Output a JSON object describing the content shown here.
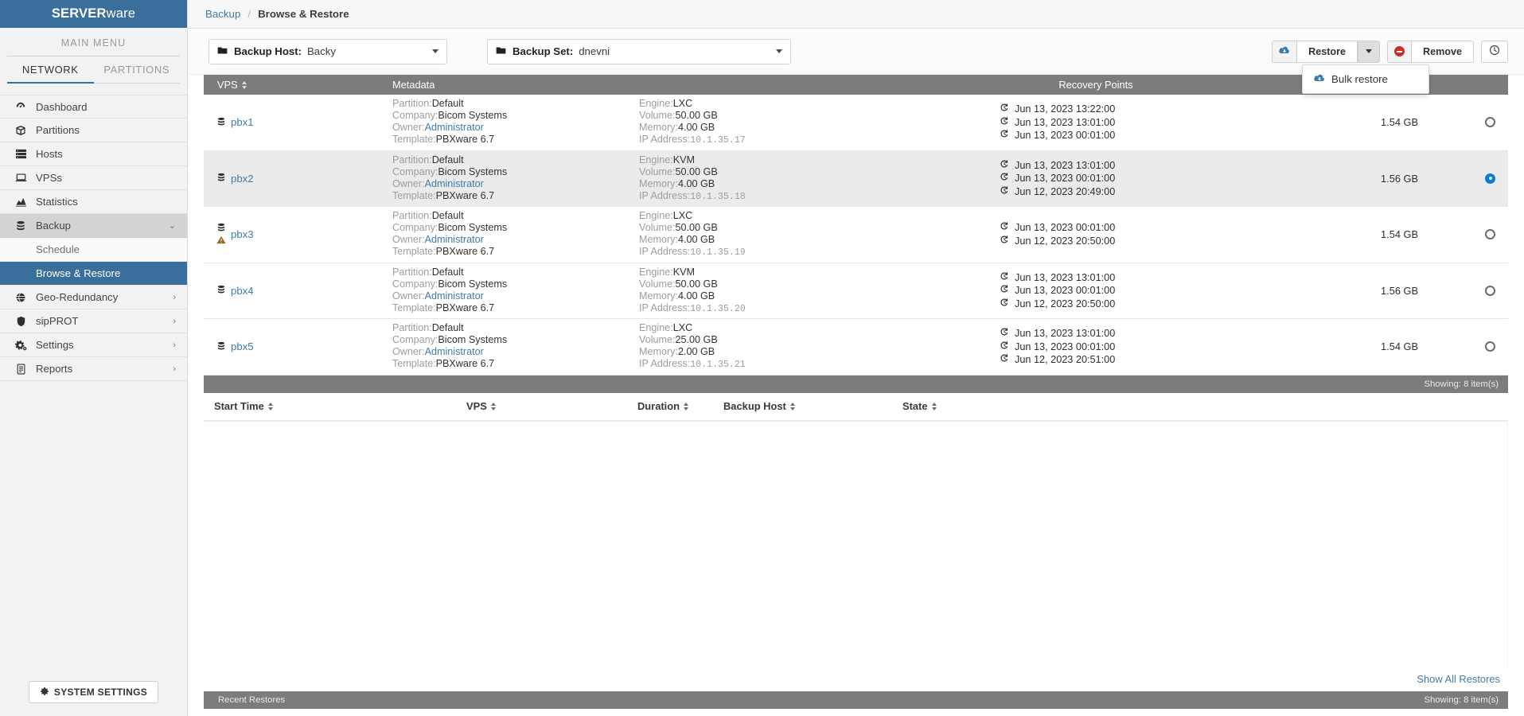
{
  "brand": {
    "bold": "SERVER",
    "light": "ware"
  },
  "sidebar": {
    "main_menu_label": "MAIN MENU",
    "tabs": [
      {
        "label": "NETWORK",
        "active": true
      },
      {
        "label": "PARTITIONS",
        "active": false
      }
    ],
    "items": [
      {
        "label": "Dashboard",
        "icon": "dashboard-icon",
        "glyph": "☉"
      },
      {
        "label": "Partitions",
        "icon": "cube-icon",
        "glyph": "⬡"
      },
      {
        "label": "Hosts",
        "icon": "server-icon",
        "glyph": "☰"
      },
      {
        "label": "VPSs",
        "icon": "laptop-icon",
        "glyph": "⬜"
      },
      {
        "label": "Statistics",
        "icon": "chart-area-icon",
        "glyph": "◢"
      },
      {
        "label": "Backup",
        "icon": "database-icon",
        "glyph": "☷",
        "expanded": true,
        "chevron": "⌄"
      },
      {
        "label": "Geo-Redundancy",
        "icon": "globe-icon",
        "glyph": "◕",
        "chevron": "›"
      },
      {
        "label": "sipPROT",
        "icon": "shield-icon",
        "glyph": "⛊",
        "chevron": "›"
      },
      {
        "label": "Settings",
        "icon": "gears-icon",
        "glyph": "⚙",
        "chevron": "›"
      },
      {
        "label": "Reports",
        "icon": "file-text-icon",
        "glyph": "☷",
        "chevron": "›"
      }
    ],
    "sub_items": [
      {
        "label": "Schedule",
        "active": false
      },
      {
        "label": "Browse & Restore",
        "active": true
      }
    ],
    "system_settings_label": "SYSTEM SETTINGS",
    "system_settings_icon": "gear-icon"
  },
  "breadcrumb": {
    "parent": "Backup",
    "separator": "/",
    "current": "Browse & Restore"
  },
  "toolbar": {
    "backup_host": {
      "label": "Backup Host:",
      "value": "Backy",
      "icon": "folder-icon"
    },
    "backup_set": {
      "label": "Backup Set:",
      "value": "dnevni",
      "icon": "folder-icon"
    },
    "restore_label": "Restore",
    "restore_icon": "cloud-download-icon",
    "remove_label": "Remove",
    "remove_icon": "ban-icon",
    "history_icon": "clock-icon",
    "dropdown": {
      "open": true,
      "items": [
        {
          "label": "Bulk restore",
          "icon": "cloud-download-icon"
        }
      ]
    }
  },
  "table": {
    "columns": [
      {
        "key": "vps",
        "label": "VPS",
        "sortable": true
      },
      {
        "key": "metadata",
        "label": "Metadata",
        "sortable": false
      },
      {
        "key": "recovery",
        "label": "Recovery Points",
        "sortable": false
      },
      {
        "key": "size",
        "label": "",
        "sortable": false
      }
    ],
    "meta_keys": {
      "partition": "Partition:",
      "company": "Company:",
      "owner": "Owner:",
      "template": "Template:",
      "engine": "Engine:",
      "volume": "Volume:",
      "memory": "Memory:",
      "ip": "IP Address:"
    },
    "rows": [
      {
        "name": "pbx1",
        "warning": false,
        "selected": false,
        "size": "1.54 GB",
        "partition": "Default",
        "company": "Bicom Systems",
        "owner": "Administrator",
        "template": "PBXware 6.7",
        "engine": "LXC",
        "volume": "50.00 GB",
        "memory": "4.00 GB",
        "ip": "10.1.35.17",
        "recovery_points": [
          "Jun 13, 2023 13:22:00",
          "Jun 13, 2023 13:01:00",
          "Jun 13, 2023 00:01:00"
        ]
      },
      {
        "name": "pbx2",
        "warning": false,
        "selected": true,
        "size": "1.56 GB",
        "partition": "Default",
        "company": "Bicom Systems",
        "owner": "Administrator",
        "template": "PBXware 6.7",
        "engine": "KVM",
        "volume": "50.00 GB",
        "memory": "4.00 GB",
        "ip": "10.1.35.18",
        "recovery_points": [
          "Jun 13, 2023 13:01:00",
          "Jun 13, 2023 00:01:00",
          "Jun 12, 2023 20:49:00"
        ]
      },
      {
        "name": "pbx3",
        "warning": true,
        "selected": false,
        "size": "1.54 GB",
        "partition": "Default",
        "company": "Bicom Systems",
        "owner": "Administrator",
        "template": "PBXware 6.7",
        "engine": "LXC",
        "volume": "50.00 GB",
        "memory": "4.00 GB",
        "ip": "10.1.35.19",
        "recovery_points": [
          "Jun 13, 2023 00:01:00",
          "Jun 12, 2023 20:50:00"
        ]
      },
      {
        "name": "pbx4",
        "warning": false,
        "selected": false,
        "size": "1.56 GB",
        "partition": "Default",
        "company": "Bicom Systems",
        "owner": "Administrator",
        "template": "PBXware 6.7",
        "engine": "KVM",
        "volume": "50.00 GB",
        "memory": "4.00 GB",
        "ip": "10.1.35.20",
        "recovery_points": [
          "Jun 13, 2023 13:01:00",
          "Jun 13, 2023 00:01:00",
          "Jun 12, 2023 20:50:00"
        ]
      },
      {
        "name": "pbx5",
        "warning": false,
        "selected": false,
        "size": "1.54 GB",
        "partition": "Default",
        "company": "Bicom Systems",
        "owner": "Administrator",
        "template": "PBXware 6.7",
        "engine": "LXC",
        "volume": "25.00 GB",
        "memory": "2.00 GB",
        "ip": "10.1.35.21",
        "recovery_points": [
          "Jun 13, 2023 13:01:00",
          "Jun 13, 2023 00:01:00",
          "Jun 12, 2023 20:51:00"
        ]
      }
    ],
    "footer_showing": "Showing: 8 item(s)"
  },
  "restores": {
    "columns": [
      {
        "label": "Start Time",
        "sortable": true
      },
      {
        "label": "VPS",
        "sortable": true
      },
      {
        "label": "Duration",
        "sortable": true
      },
      {
        "label": "Backup Host",
        "sortable": true
      },
      {
        "label": "State",
        "sortable": true
      }
    ],
    "rows": [],
    "show_all_label": "Show All Restores",
    "bar_title": "Recent Restores",
    "bar_showing": "Showing: 8 item(s)"
  },
  "colors": {
    "brand_blue": "#3a6e9b",
    "link_blue": "#3f7ba8",
    "header_gray": "#7c7c7c",
    "radio_on": "#0a7cd6",
    "danger_red": "#c9302c",
    "warning_amber": "#9a6b1e"
  }
}
